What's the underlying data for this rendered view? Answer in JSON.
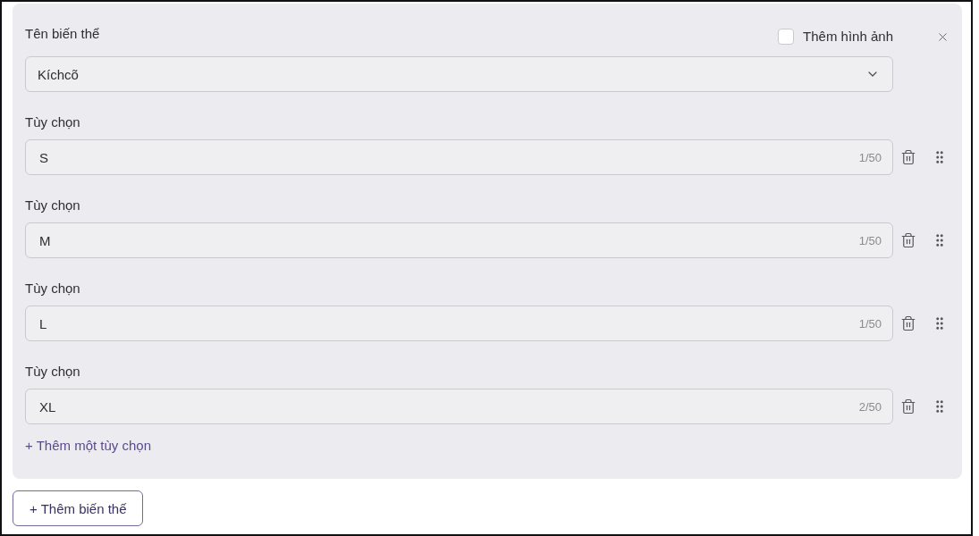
{
  "variant": {
    "name_label": "Tên biến thể",
    "add_image": {
      "label": "Thêm hình ảnh",
      "checked": false
    },
    "type_select": {
      "value": "Kíchcõ"
    },
    "options": [
      {
        "label": "Tùy chọn",
        "value": "S",
        "counter": "1/50"
      },
      {
        "label": "Tùy chọn",
        "value": "M",
        "counter": "1/50"
      },
      {
        "label": "Tùy chọn",
        "value": "L",
        "counter": "1/50"
      },
      {
        "label": "Tùy chọn",
        "value": "XL",
        "counter": "2/50"
      }
    ],
    "add_option_link": "+ Thêm một tùy chọn"
  },
  "add_variant_button": "+ Thêm biến thế"
}
